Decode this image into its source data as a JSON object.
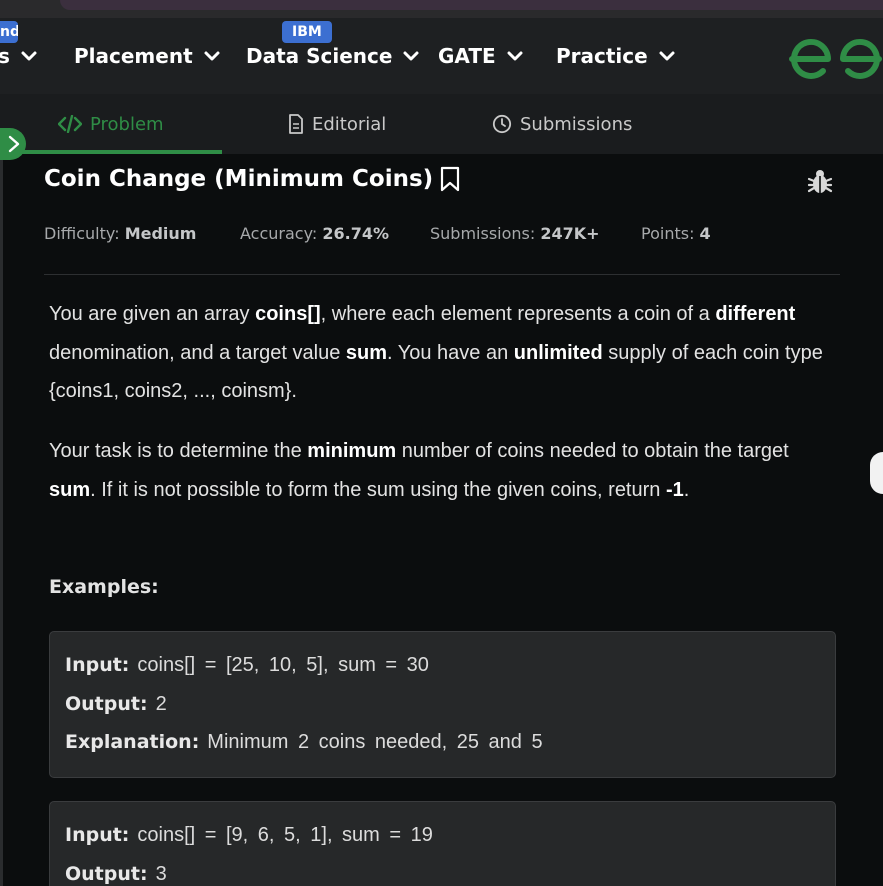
{
  "nav": {
    "partial_badge": "nd",
    "partial_item": "s",
    "items": [
      "Placement",
      "Data Science",
      "GATE",
      "Practice"
    ],
    "ibm_badge": "IBM",
    "brand_color": "#2f8d46"
  },
  "tabs": {
    "problem": "Problem",
    "editorial": "Editorial",
    "submissions": "Submissions"
  },
  "problem": {
    "title": "Coin Change (Minimum Coins)",
    "difficulty_label": "Difficulty:",
    "difficulty": "Medium",
    "accuracy_label": "Accuracy:",
    "accuracy": "26.74%",
    "submissions_label": "Submissions:",
    "submissions": "247K+",
    "points_label": "Points:",
    "points": "4",
    "p1": {
      "a": "You are given an array ",
      "b": "coins[]",
      "c": ", where each element represents a coin of a ",
      "d": "different",
      "e": " denomination, and a target value ",
      "f": "sum",
      "g": ". You have an ",
      "h": "unlimited",
      "i": " supply of each coin type {coins1, coins2, ..., coinsm}."
    },
    "p2": {
      "a": "Your task is to determine the ",
      "b": "minimum",
      "c": " number of coins needed to obtain the target ",
      "d": "sum",
      "e": ". If it is not possible to form the sum using the given coins, return ",
      "f": "-1",
      "g": "."
    },
    "examples_label": "Examples:",
    "examples": [
      {
        "input_label": "Input:",
        "input": "coins[] = [25, 10, 5], sum = 30",
        "output_label": "Output:",
        "output": "2",
        "explanation_label": "Explanation:",
        "explanation": "Minimum 2 coins needed, 25 and 5"
      },
      {
        "input_label": "Input:",
        "input": "coins[] = [9, 6, 5, 1], sum = 19",
        "output_label": "Output:",
        "output": "3"
      }
    ]
  }
}
